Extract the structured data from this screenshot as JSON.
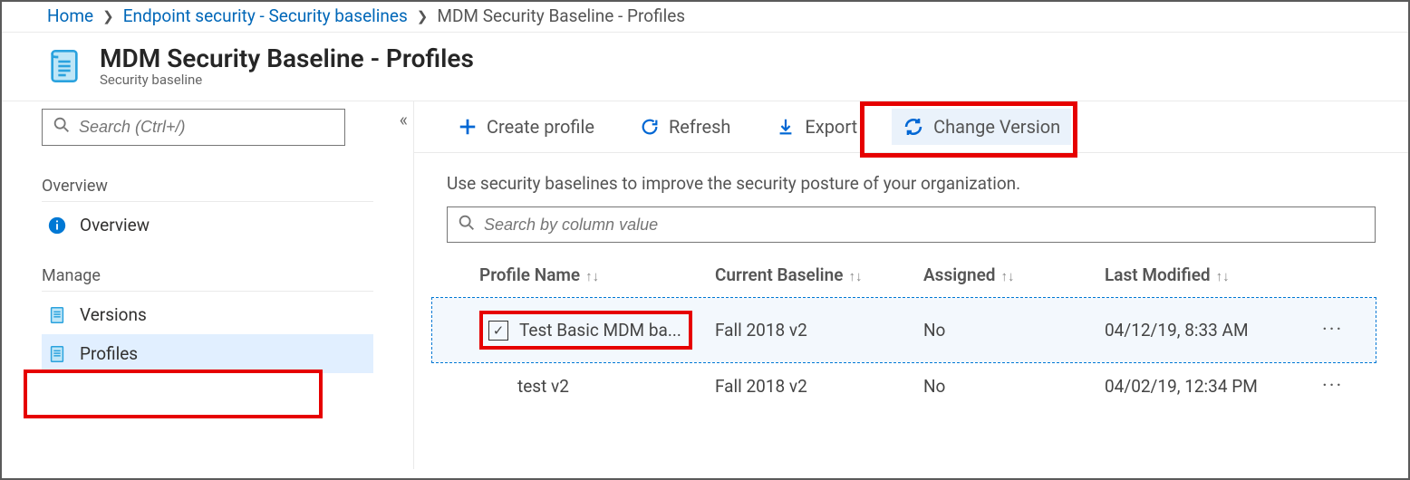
{
  "breadcrumb": {
    "items": [
      {
        "label": "Home",
        "link": true
      },
      {
        "label": "Endpoint security - Security baselines",
        "link": true
      },
      {
        "label": "MDM Security Baseline - Profiles",
        "link": false
      }
    ]
  },
  "header": {
    "title": "MDM Security Baseline - Profiles",
    "subtitle": "Security baseline"
  },
  "sidebar": {
    "search_placeholder": "Search (Ctrl+/)",
    "groups": [
      {
        "label": "Overview",
        "items": [
          {
            "icon": "info-icon",
            "label": "Overview"
          }
        ]
      },
      {
        "label": "Manage",
        "items": [
          {
            "icon": "doc-icon",
            "label": "Versions"
          },
          {
            "icon": "doc-icon",
            "label": "Profiles",
            "active": true
          }
        ]
      }
    ]
  },
  "toolbar": {
    "create": "Create profile",
    "refresh": "Refresh",
    "export": "Export",
    "change_version": "Change Version"
  },
  "main": {
    "description": "Use security baselines to improve the security posture of your organization.",
    "column_search_placeholder": "Search by column value",
    "columns": {
      "profile_name": "Profile Name",
      "current_baseline": "Current Baseline",
      "assigned": "Assigned",
      "last_modified": "Last Modified"
    },
    "rows": [
      {
        "selected": true,
        "profile_name": "Test Basic MDM ba...",
        "current_baseline": "Fall 2018 v2",
        "assigned": "No",
        "last_modified": "04/12/19, 8:33 AM"
      },
      {
        "selected": false,
        "profile_name": "test v2",
        "current_baseline": "Fall 2018 v2",
        "assigned": "No",
        "last_modified": "04/02/19, 12:34 PM"
      }
    ]
  }
}
